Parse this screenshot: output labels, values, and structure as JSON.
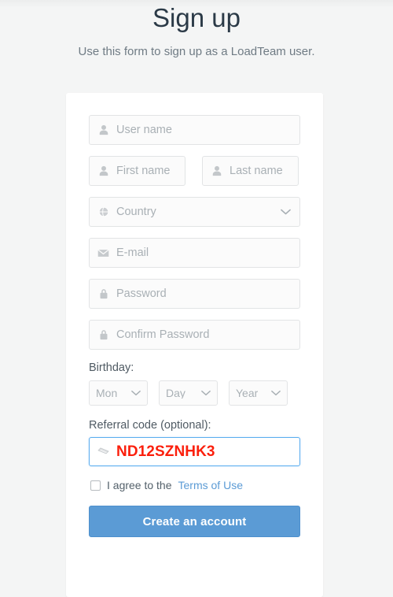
{
  "header": {
    "title": "Sign up",
    "subtitle": "Use this form to sign up as a LoadTeam user."
  },
  "form": {
    "username": {
      "placeholder": "User name",
      "value": "",
      "icon": "user-icon"
    },
    "first_name": {
      "placeholder": "First name",
      "value": "",
      "icon": "user-icon"
    },
    "last_name": {
      "placeholder": "Last name",
      "value": "",
      "icon": "user-icon"
    },
    "country": {
      "placeholder": "Country",
      "value": "",
      "icon": "globe-icon"
    },
    "email": {
      "placeholder": "E-mail",
      "value": "",
      "icon": "envelope-icon"
    },
    "password": {
      "placeholder": "Password",
      "value": "",
      "icon": "lock-icon"
    },
    "confirm_password": {
      "placeholder": "Confirm Password",
      "value": "",
      "icon": "lock-icon"
    },
    "birthday": {
      "label": "Birthday:",
      "month": "Mon",
      "day": "Day",
      "year": "Year"
    },
    "referral": {
      "label": "Referral code (optional):",
      "value": "ND12SZNHK3",
      "icon": "ticket-icon",
      "focused": true
    },
    "terms": {
      "checked": false,
      "text": "I agree to the",
      "link_label": "Terms of Use"
    },
    "submit_label": "Create an account"
  },
  "colors": {
    "page_background": "#f4f5f5",
    "card_background": "#ffffff",
    "title": "#2b3a47",
    "subtitle": "#6f7b84",
    "placeholder": "#a9b0b5",
    "input_border": "#e2e4e5",
    "focus_border": "#5badef",
    "referral_value": "#fb1f0c",
    "link": "#5b9bd5",
    "button": "#5b9bd5",
    "button_text": "#ffffff"
  }
}
